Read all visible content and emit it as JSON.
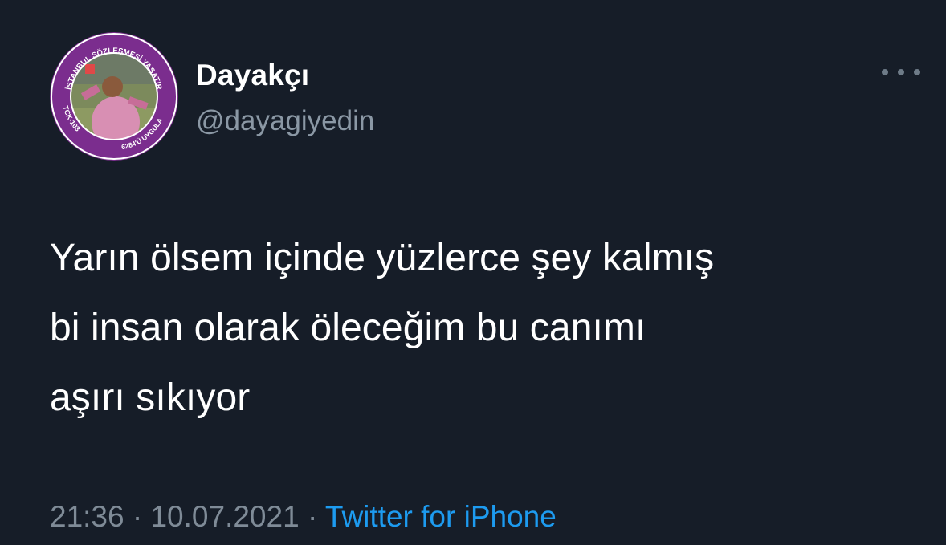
{
  "author": {
    "display_name": "Dayakçı",
    "handle": "@dayagiyedin",
    "avatar_badge_text": [
      "İSTANBUL SÖZLEŞMESİ YAŞATIR",
      "TCK-103",
      "6284'Ü UYGULA"
    ]
  },
  "menu": {
    "icon": "more-horizontal-icon"
  },
  "tweet": {
    "text": "Yarın ölsem içinde yüzlerce şey kalmış\nbi insan olarak öleceğim bu canımı\naşırı sıkıyor",
    "time": "21:36",
    "separator": "·",
    "date": "10.07.2021",
    "source": "Twitter for iPhone"
  },
  "colors": {
    "background": "#161d28",
    "text_primary": "#ffffff",
    "text_secondary": "#8b98a5",
    "link": "#1d9bf0",
    "avatar_ring": "#7b2d8e"
  }
}
